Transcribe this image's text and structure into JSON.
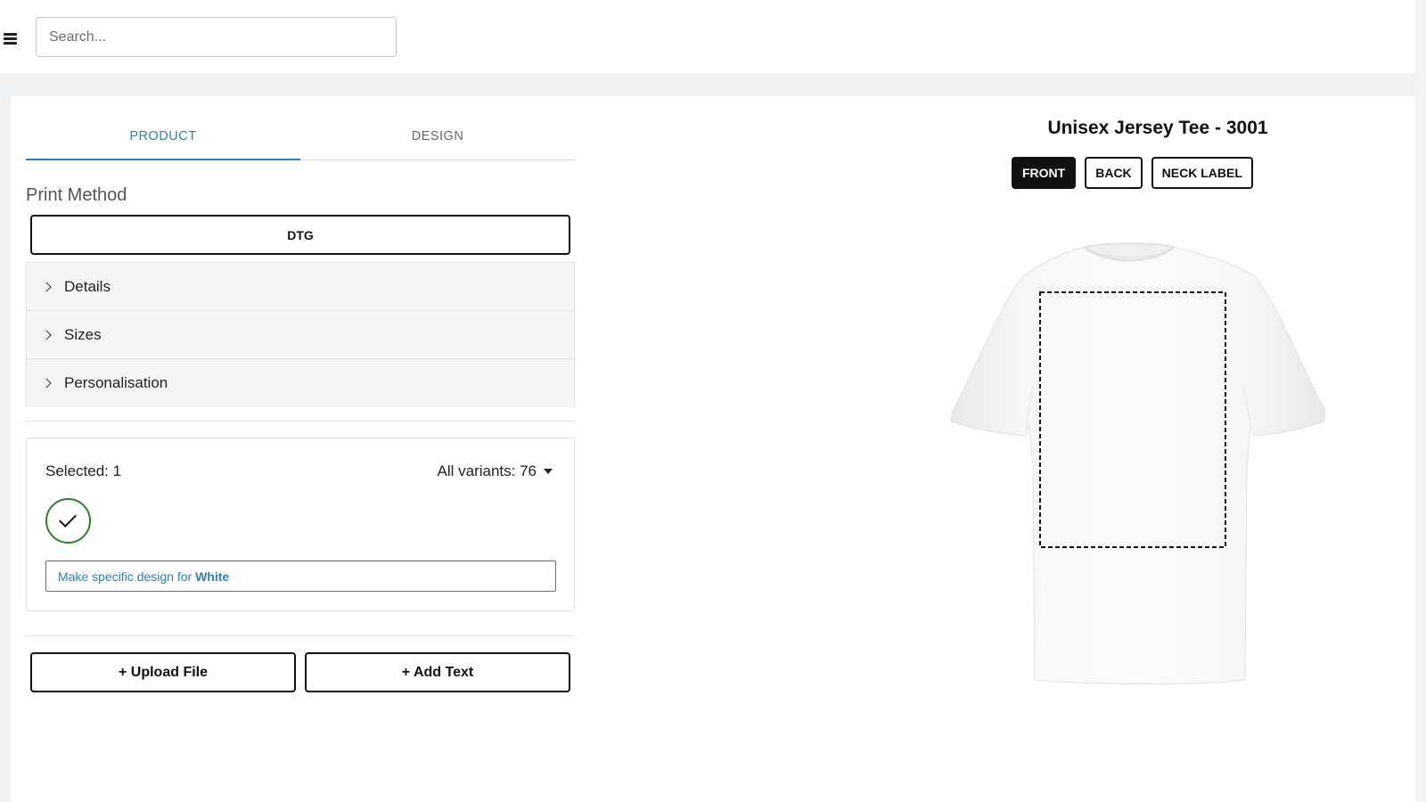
{
  "topbar": {
    "menu_icon": "hamburger-menu-icon",
    "search_placeholder": "Search..."
  },
  "tabs": [
    {
      "label": "PRODUCT",
      "active": true
    },
    {
      "label": "DESIGN",
      "active": false
    }
  ],
  "print_method": {
    "label": "Print Method",
    "value": "DTG"
  },
  "accordion": {
    "icon": "chevron-right-icon",
    "items": [
      "Details",
      "Sizes",
      "Personalisation"
    ]
  },
  "variants": {
    "selected_text": "Selected: 1",
    "all_variants_text": "All variants: 76",
    "swatch_color": "#ffffff",
    "swatch_border_color": "#2e7d32",
    "swatch_icon": "check-icon",
    "specific_prefix": "Make specific design for",
    "specific_color": "White"
  },
  "actions": {
    "upload": "+ Upload File",
    "add_text": "+ Add Text"
  },
  "product": {
    "title": "Unisex Jersey Tee - 3001",
    "views": [
      {
        "label": "FRONT",
        "active": true
      },
      {
        "label": "BACK",
        "active": false
      },
      {
        "label": "NECK LABEL",
        "active": false
      }
    ],
    "mockup": "white-tshirt-front-mockup"
  },
  "colors": {
    "accent": "#2a7fbf",
    "active_view_bg": "#111111"
  }
}
